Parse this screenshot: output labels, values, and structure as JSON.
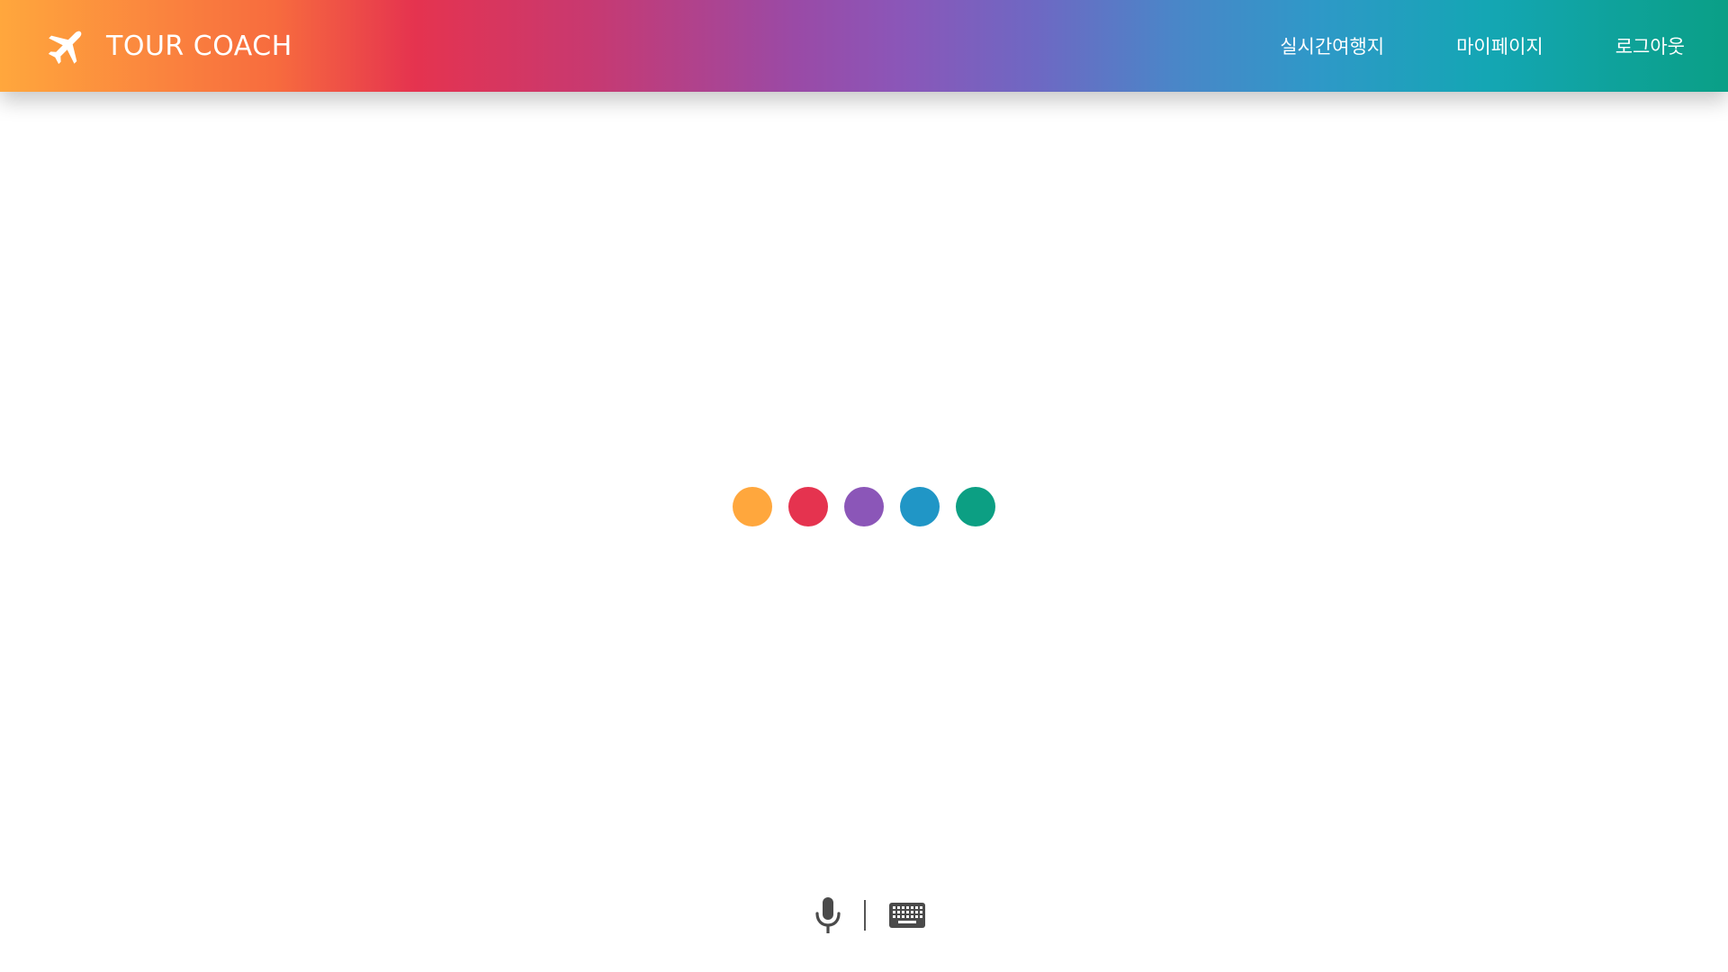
{
  "app": {
    "brand_name": "TOUR COACH",
    "logo_icon": "airplane-icon"
  },
  "nav": {
    "items": [
      {
        "label": "실시간여행지"
      },
      {
        "label": "마이페이지"
      },
      {
        "label": "로그아웃"
      }
    ]
  },
  "theme": {
    "header_gradient": [
      "#ffa73d",
      "#e5334f",
      "#8b56b8",
      "#2f98c8",
      "#0a9f86"
    ],
    "text_on_header": "#ffffff"
  },
  "loading_indicator": {
    "dots": [
      {
        "color": "#ffa73d"
      },
      {
        "color": "#e5334f"
      },
      {
        "color": "#8b56b8"
      },
      {
        "color": "#2096c6"
      },
      {
        "color": "#0c9f83"
      }
    ]
  },
  "input_controls": {
    "mic_icon": "microphone-icon",
    "keyboard_icon": "keyboard-icon",
    "icon_color": "#4a4a4a"
  }
}
